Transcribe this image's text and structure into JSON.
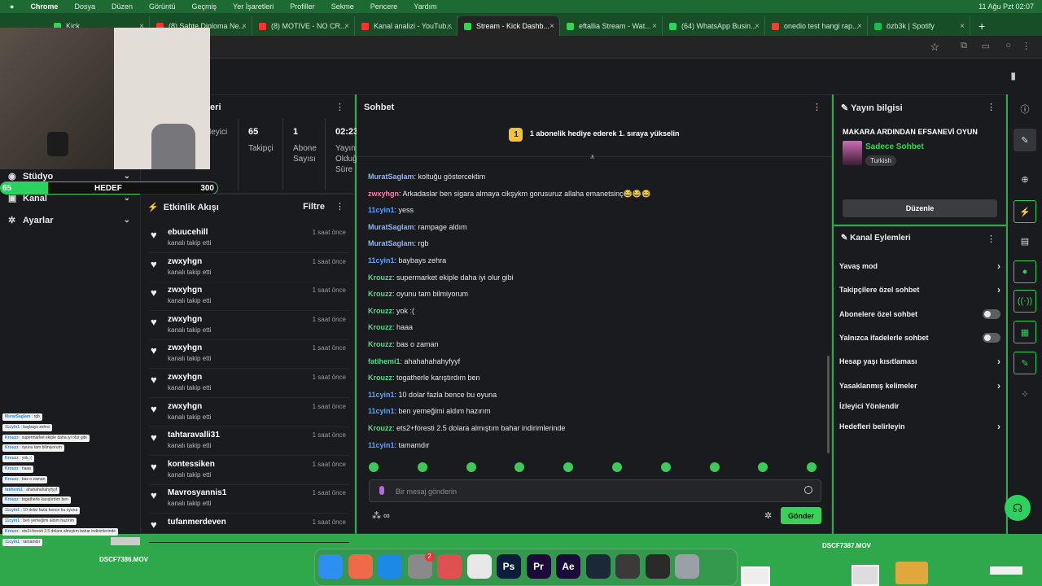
{
  "menubar": {
    "app": "Chrome",
    "items": [
      "Dosya",
      "Düzen",
      "Görüntü",
      "Geçmiş",
      "Yer İşaretleri",
      "Profiller",
      "Sekme",
      "Pencere",
      "Yardım"
    ],
    "clock": "11 Ağu Pzt 02:07"
  },
  "tabs": [
    {
      "label": "Kick",
      "color": "#3bd157"
    },
    {
      "label": "(8) Sahte Diploma Ne...",
      "color": "#ff3030"
    },
    {
      "label": "(8) MOTIVE - NO CR...",
      "color": "#ff3030"
    },
    {
      "label": "Kanal analizi - YouTub...",
      "color": "#ff3030"
    },
    {
      "label": "Stream - Kick Dashb...",
      "color": "#3bd157"
    },
    {
      "label": "eftallia Stream - Wat...",
      "color": "#3bd157"
    },
    {
      "label": "(64) WhatsApp Busin...",
      "color": "#2bd25d"
    },
    {
      "label": "onedio test hangi rap...",
      "color": "#ea4335"
    },
    {
      "label": "özb3k | Spotify",
      "color": "#1db954"
    }
  ],
  "leftnav": {
    "items": [
      {
        "label": "Stüdyo"
      },
      {
        "label": "Kanal"
      },
      {
        "label": "Ayarlar"
      }
    ]
  },
  "goal": {
    "current": "65",
    "label": "HEDEF",
    "max": "300",
    "progress": 0.2167
  },
  "stats": {
    "title_fragment": "leri",
    "columns": [
      {
        "value": "",
        "label": "leyici"
      },
      {
        "value": "65",
        "label": "Takipçi"
      },
      {
        "value": "1",
        "label": "Abone Sayısı"
      },
      {
        "value": "02:23",
        "label": "Yayın Olduğ Süre"
      }
    ]
  },
  "feed": {
    "title": "Etkinlik Akışı",
    "filter": "Filtre",
    "items": [
      {
        "name": "ebuucehill",
        "action": "kanalı takip etti",
        "time": "1 saat önce"
      },
      {
        "name": "zwxyhgn",
        "action": "kanalı takip etti",
        "time": "1 saat önce"
      },
      {
        "name": "zwxyhgn",
        "action": "kanalı takip etti",
        "time": "1 saat önce"
      },
      {
        "name": "zwxyhgn",
        "action": "kanalı takip etti",
        "time": "1 saat önce"
      },
      {
        "name": "zwxyhgn",
        "action": "kanalı takip etti",
        "time": "1 saat önce"
      },
      {
        "name": "zwxyhgn",
        "action": "kanalı takip etti",
        "time": "1 saat önce"
      },
      {
        "name": "zwxyhgn",
        "action": "kanalı takip etti",
        "time": "1 saat önce"
      },
      {
        "name": "tahtaravalli31",
        "action": "kanalı takip etti",
        "time": "1 saat önce"
      },
      {
        "name": "kontessiken",
        "action": "kanalı takip etti",
        "time": "1 saat önce"
      },
      {
        "name": "Mavrosyannis1",
        "action": "kanalı takip etti",
        "time": "1 saat önce"
      },
      {
        "name": "tufanmerdeven",
        "action": "",
        "time": "1 saat önce"
      }
    ]
  },
  "chat": {
    "title": "Sohbet",
    "pinned_badge": "1",
    "pinned": "1 abonelik hediye ederek 1. sıraya yükselin",
    "messages": [
      {
        "user": "MuratSaglam",
        "text": "koltuğu göstercektim",
        "color": "#8fb4f0"
      },
      {
        "user": "zwxyhgn",
        "text": "Arkadaslar ben sigara almaya cikşykm gorusuruz allaha emanetsinç😂😂😂",
        "color": "#ff7ab0"
      },
      {
        "user": "11cyin1",
        "text": "yess",
        "color": "#5aa0ff"
      },
      {
        "user": "MuratSaglam",
        "text": "rampage aldım",
        "color": "#8fb4f0"
      },
      {
        "user": "MuratSaglam",
        "text": "rgb",
        "color": "#8fb4f0"
      },
      {
        "user": "11cyin1",
        "text": "baybays zehra",
        "color": "#5aa0ff"
      },
      {
        "user": "Krouzz",
        "text": "supermarket ekiple daha iyi olur gibi",
        "color": "#52d98a"
      },
      {
        "user": "Krouzz",
        "text": "oyunu tam bilmiyorum",
        "color": "#52d98a"
      },
      {
        "user": "Krouzz",
        "text": "yok :(",
        "color": "#52d98a"
      },
      {
        "user": "Krouzz",
        "text": "haaa",
        "color": "#52d98a"
      },
      {
        "user": "Krouzz",
        "text": "bas o zaman",
        "color": "#52d98a"
      },
      {
        "user": "fatihemi1",
        "text": "ahahahahahyfyyf",
        "color": "#52d98a"
      },
      {
        "user": "Krouzz",
        "text": "togatherle karıştırdım ben",
        "color": "#52d98a"
      },
      {
        "user": "11cyin1",
        "text": "10 dolar fazla bence bu oyuna",
        "color": "#5aa0ff"
      },
      {
        "user": "11cyin1",
        "text": "ben yemeğimi aldım hazırım",
        "color": "#5aa0ff"
      },
      {
        "user": "Krouzz",
        "text": "ets2+foresti 2.5 dolara almıştım bahar indirimlerinde",
        "color": "#52d98a"
      },
      {
        "user": "11cyin1",
        "text": "tamamdır",
        "color": "#5aa0ff"
      }
    ],
    "input_placeholder": "Bir mesaj gönderin",
    "send": "Gönder"
  },
  "info": {
    "title": "Yayın bilgisi",
    "stream_title": "MAKARA ARDINDAN EFSANEVİ OYUN",
    "category": "Sadece Sohbet",
    "language": "Turkish",
    "edit": "Düzenle"
  },
  "actions": {
    "title": "Kanal Eylemleri",
    "items": [
      {
        "label": "Yavaş mod",
        "kind": "chevron"
      },
      {
        "label": "Takipçilere özel sohbet",
        "kind": "chevron"
      },
      {
        "label": "Abonelere özel sohbet",
        "kind": "toggle"
      },
      {
        "label": "Yalnızca ifadelerle sohbet",
        "kind": "toggle"
      },
      {
        "label": "Hesap yaşı kısıtlaması",
        "kind": "chevron"
      },
      {
        "label": "Yasaklanmış kelimeler",
        "kind": "chevron"
      },
      {
        "label": "İzleyici Yönlendir",
        "kind": "none"
      },
      {
        "label": "Hedefleri belirleyin",
        "kind": "chevron"
      }
    ]
  },
  "mini_chat": [
    {
      "user": "MuratSaglam",
      "text": "rgb"
    },
    {
      "user": "11cyin1",
      "text": "baybays zehra"
    },
    {
      "user": "Krouzz",
      "text": "supermarket ekiple daha iyi olur gibi"
    },
    {
      "user": "Krouzz",
      "text": "oyunu tam bilmiyorum"
    },
    {
      "user": "Krouzz",
      "text": "yok :("
    },
    {
      "user": "Krouzz",
      "text": "haaa"
    },
    {
      "user": "Krouzz",
      "text": "bas o zaman"
    },
    {
      "user": "fatihemi1",
      "text": "ahahahahahyfyyf"
    },
    {
      "user": "Krouzz",
      "text": "togatherle karıştırdım ben"
    },
    {
      "user": "11cyin1",
      "text": "10 dolar fazla bence bu oyuna"
    },
    {
      "user": "11cyin1",
      "text": "ben yemeğimi aldım hazırım"
    },
    {
      "user": "Krouzz",
      "text": "ets2+foresti 2.5 dolara almıştım bahar indirimlerinde"
    },
    {
      "user": "11cyin1",
      "text": "tamamdır"
    }
  ],
  "desktop": {
    "file1": "DSCF7386.MOV",
    "file2": "DSCF7387.MOV"
  },
  "dock": {
    "apps": [
      {
        "name": "finder-icon",
        "color": "#2f8ff0",
        "label": ""
      },
      {
        "name": "launchpad-icon",
        "color": "#f06a4a",
        "label": ""
      },
      {
        "name": "safari-icon",
        "color": "#1e88e5",
        "label": ""
      },
      {
        "name": "settings-icon",
        "color": "#8a8a8a",
        "label": "",
        "badge": "2"
      },
      {
        "name": "notes-icon",
        "color": "#e05050",
        "label": ""
      },
      {
        "name": "chrome-icon",
        "color": "#e8e8e8",
        "label": ""
      },
      {
        "name": "photoshop-icon",
        "color": "#0a1d3a",
        "label": "Ps"
      },
      {
        "name": "premiere-icon",
        "color": "#1c0b3a",
        "label": "Pr"
      },
      {
        "name": "after-effects-icon",
        "color": "#1a0b3a",
        "label": "Ae"
      },
      {
        "name": "steam-icon",
        "color": "#1b2838",
        "label": ""
      },
      {
        "name": "calculator-icon",
        "color": "#3a3a3a",
        "label": ""
      },
      {
        "name": "obs-icon",
        "color": "#2a2a2a",
        "label": ""
      },
      {
        "name": "trash-icon",
        "color": "#9aa0a6",
        "label": ""
      }
    ]
  }
}
